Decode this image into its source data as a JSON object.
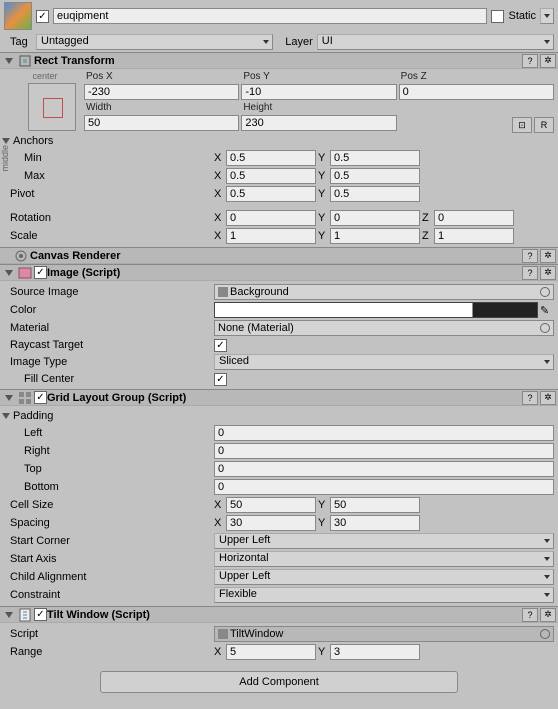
{
  "header": {
    "enabled": true,
    "name": "euqipment",
    "static": false,
    "static_label": "Static",
    "tag_label": "Tag",
    "tag_value": "Untagged",
    "layer_label": "Layer",
    "layer_value": "UI"
  },
  "rect_transform": {
    "title": "Rect Transform",
    "anchor_preset_v": "middle",
    "anchor_preset_h": "center",
    "posx_label": "Pos X",
    "posy_label": "Pos Y",
    "posz_label": "Pos Z",
    "posx": "-230",
    "posy": "-10",
    "posz": "0",
    "width_label": "Width",
    "height_label": "Height",
    "width": "50",
    "height": "230",
    "btn_raw": "⊡",
    "btn_r": "R",
    "anchors_label": "Anchors",
    "min_label": "Min",
    "max_label": "Max",
    "min_x": "0.5",
    "min_y": "0.5",
    "max_x": "0.5",
    "max_y": "0.5",
    "pivot_label": "Pivot",
    "pivot_x": "0.5",
    "pivot_y": "0.5",
    "rotation_label": "Rotation",
    "rot_x": "0",
    "rot_y": "0",
    "rot_z": "0",
    "scale_label": "Scale",
    "scale_x": "1",
    "scale_y": "1",
    "scale_z": "1"
  },
  "canvas_renderer": {
    "title": "Canvas Renderer"
  },
  "image": {
    "title": "Image (Script)",
    "src_label": "Source Image",
    "src_value": "Background",
    "color_label": "Color",
    "material_label": "Material",
    "material_value": "None (Material)",
    "raycast_label": "Raycast Target",
    "raycast": true,
    "imgtype_label": "Image Type",
    "imgtype_value": "Sliced",
    "fill_label": "Fill Center",
    "fill": true
  },
  "grid": {
    "title": "Grid Layout Group (Script)",
    "padding_label": "Padding",
    "left_label": "Left",
    "right_label": "Right",
    "top_label": "Top",
    "bottom_label": "Bottom",
    "left": "0",
    "right": "0",
    "top": "0",
    "bottom": "0",
    "cell_label": "Cell Size",
    "cell_x": "50",
    "cell_y": "50",
    "spacing_label": "Spacing",
    "spacing_x": "30",
    "spacing_y": "30",
    "start_corner_label": "Start Corner",
    "start_corner": "Upper Left",
    "start_axis_label": "Start Axis",
    "start_axis": "Horizontal",
    "child_align_label": "Child Alignment",
    "child_align": "Upper Left",
    "constraint_label": "Constraint",
    "constraint": "Flexible"
  },
  "tilt": {
    "title": "Tilt Window (Script)",
    "script_label": "Script",
    "script_value": "TiltWindow",
    "range_label": "Range",
    "range_x": "5",
    "range_y": "3"
  },
  "add_component": "Add Component",
  "axis": {
    "x": "X",
    "y": "Y",
    "z": "Z"
  },
  "icons": {
    "help": "?",
    "gear": "✲"
  }
}
